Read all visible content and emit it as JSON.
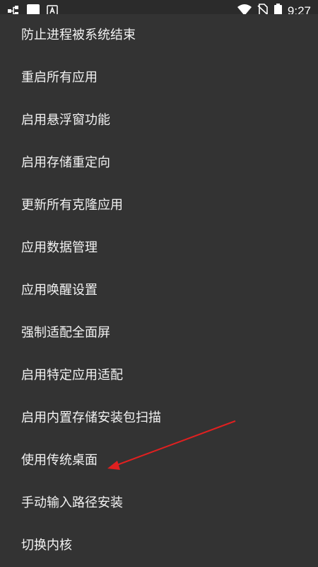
{
  "status_bar": {
    "time": "9:27",
    "icons": [
      "network-icon",
      "app-icon-white",
      "app-icon-a",
      "wifi-icon",
      "no-sim-icon",
      "battery-icon"
    ]
  },
  "menu": {
    "items": [
      {
        "label": "防止进程被系统结束"
      },
      {
        "label": "重启所有应用"
      },
      {
        "label": "启用悬浮窗功能"
      },
      {
        "label": "启用存储重定向"
      },
      {
        "label": "更新所有克隆应用"
      },
      {
        "label": "应用数据管理"
      },
      {
        "label": "应用唤醒设置"
      },
      {
        "label": "强制适配全面屏"
      },
      {
        "label": "启用特定应用适配"
      },
      {
        "label": "启用内置存储安装包扫描"
      },
      {
        "label": "使用传统桌面"
      },
      {
        "label": "手动输入路径安装"
      },
      {
        "label": "切换内核"
      }
    ]
  },
  "colors": {
    "background": "#333333",
    "status_bar": "#2b2b2b",
    "text": "#f2f2f2",
    "annotation_arrow": "#e02020"
  }
}
